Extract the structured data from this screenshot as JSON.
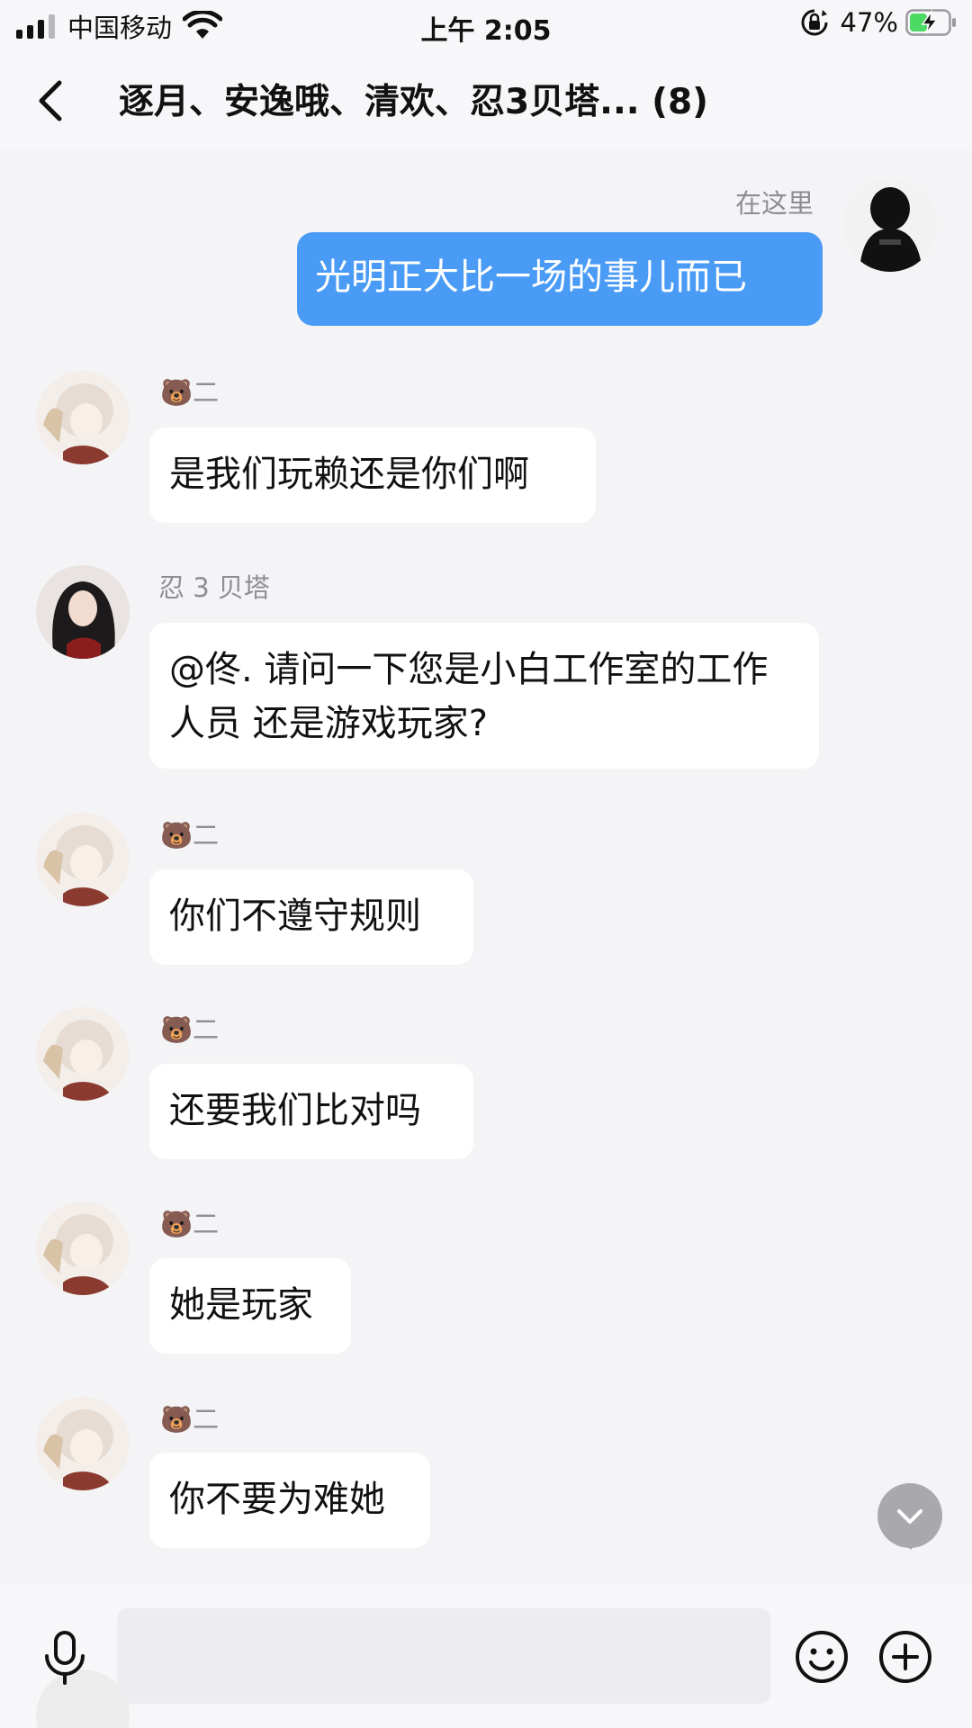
{
  "status_bar": {
    "carrier": "中国移动",
    "time": "上午 2:05",
    "battery_percent": "47%",
    "signal_bars": 4,
    "signal_active": 3,
    "battery_level": 0.47,
    "battery_color": "#4cd964"
  },
  "nav": {
    "back_icon": "chevron-left-icon",
    "title": "逐月、安逸哦、清欢、忍3贝塔... (8)"
  },
  "messages": [
    {
      "sender": "在这里",
      "text": "光明正大比一场的事儿而已",
      "mine": true,
      "avatar": "dark-hooded-avatar"
    },
    {
      "sender": "🐻二",
      "text": "是我们玩赖还是你们啊",
      "mine": false,
      "avatar": "white-hair-anime-avatar"
    },
    {
      "sender": "忍 3 贝塔",
      "text": "@佟. 请问一下您是小白工作室的工作人员 还是游戏玩家?",
      "mine": false,
      "avatar": "dark-hair-girl-avatar"
    },
    {
      "sender": "🐻二",
      "text": "你们不遵守规则",
      "mine": false,
      "avatar": "white-hair-anime-avatar"
    },
    {
      "sender": "🐻二",
      "text": "还要我们比对吗",
      "mine": false,
      "avatar": "white-hair-anime-avatar"
    },
    {
      "sender": "🐻二",
      "text": "她是玩家",
      "mine": false,
      "avatar": "white-hair-anime-avatar"
    },
    {
      "sender": "🐻二",
      "text": "你不要为难她",
      "mine": false,
      "avatar": "white-hair-anime-avatar"
    }
  ],
  "input": {
    "value": "",
    "placeholder": "",
    "mic_icon": "microphone-icon",
    "emoji_icon": "smiley-icon",
    "plus_icon": "plus-circle-icon"
  },
  "scroll_fab_icon": "chevron-down-icon",
  "colors": {
    "background": "#f4f4f6",
    "my_bubble": "#4a9bf5",
    "other_bubble": "#ffffff",
    "name_gray": "#8e8e93"
  }
}
